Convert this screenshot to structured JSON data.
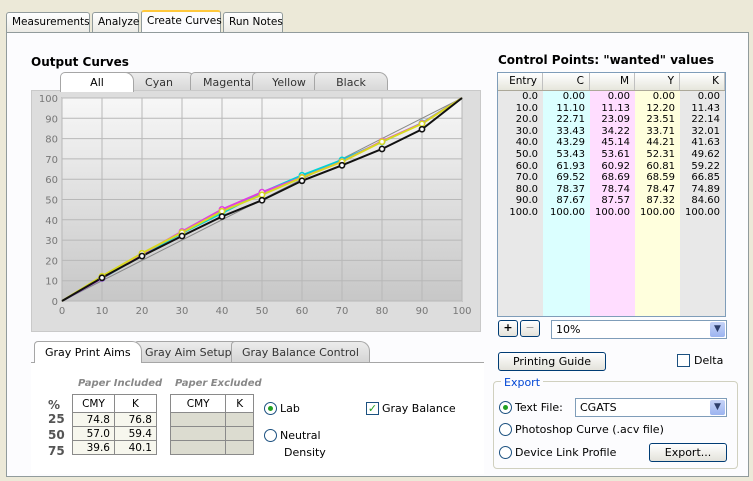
{
  "top_tabs": [
    "Measurements",
    "Analyze",
    "Create Curves",
    "Run Notes"
  ],
  "top_tab_active": "Create Curves",
  "output_curves": {
    "title": "Output Curves",
    "channel_tabs": [
      "All",
      "Cyan",
      "Magenta",
      "Yellow",
      "Black"
    ],
    "active_tab": "All"
  },
  "chart_data": {
    "type": "line",
    "x_ticks": [
      "0",
      "10",
      "20",
      "30",
      "40",
      "50",
      "60",
      "70",
      "80",
      "90",
      "100"
    ],
    "y_ticks": [
      "0",
      "10",
      "20",
      "30",
      "40",
      "50",
      "60",
      "70",
      "80",
      "90",
      "100"
    ],
    "xlim": [
      0,
      100
    ],
    "ylim": [
      0,
      100
    ],
    "grid": true,
    "x": [
      0,
      10,
      20,
      30,
      40,
      50,
      60,
      70,
      80,
      90,
      100
    ],
    "series": [
      {
        "color": "#00d4d4",
        "values": [
          0,
          11.1,
          22.71,
          33.43,
          43.29,
          53.43,
          61.93,
          69.52,
          78.37,
          87.67,
          100
        ]
      },
      {
        "color": "#e040e0",
        "values": [
          0,
          11.13,
          23.09,
          34.22,
          45.14,
          53.61,
          60.92,
          68.69,
          78.74,
          87.57,
          100
        ]
      },
      {
        "color": "#d8d820",
        "values": [
          0,
          12.2,
          23.51,
          33.71,
          44.21,
          52.31,
          60.81,
          68.59,
          78.47,
          87.32,
          100
        ]
      },
      {
        "color": "#111111",
        "values": [
          0,
          11.43,
          22.14,
          32.01,
          41.63,
          49.62,
          59.22,
          66.85,
          74.89,
          84.6,
          100
        ]
      }
    ]
  },
  "bottom_tabs": [
    "Gray Print Aims",
    "Gray Aim Setup",
    "Gray Balance Control"
  ],
  "bottom_tab_active": "Gray Print Aims",
  "gray_aims": {
    "pct_label": "%",
    "rows": [
      "25",
      "50",
      "75"
    ],
    "paper_included": {
      "title": "Paper Included",
      "headers": [
        "CMY",
        "K"
      ],
      "values": [
        [
          "74.8",
          "76.8"
        ],
        [
          "57.0",
          "59.4"
        ],
        [
          "39.6",
          "40.1"
        ]
      ]
    },
    "paper_excluded": {
      "title": "Paper Excluded",
      "headers": [
        "CMY",
        "K"
      ]
    },
    "mode_options": [
      "Lab",
      "Neutral",
      "Density"
    ],
    "mode_selected": "Lab",
    "gray_balance_label": "Gray Balance",
    "gray_balance_checked": true
  },
  "control_points": {
    "title": "Control Points: \"wanted\" values",
    "headers": [
      "Entry",
      "C",
      "M",
      "Y",
      "K"
    ],
    "rows": [
      [
        "0.0",
        "0.00",
        "0.00",
        "0.00",
        "0.00"
      ],
      [
        "10.0",
        "11.10",
        "11.13",
        "12.20",
        "11.43"
      ],
      [
        "20.0",
        "22.71",
        "23.09",
        "23.51",
        "22.14"
      ],
      [
        "30.0",
        "33.43",
        "34.22",
        "33.71",
        "32.01"
      ],
      [
        "40.0",
        "43.29",
        "45.14",
        "44.21",
        "41.63"
      ],
      [
        "50.0",
        "53.43",
        "53.61",
        "52.31",
        "49.62"
      ],
      [
        "60.0",
        "61.93",
        "60.92",
        "60.81",
        "59.22"
      ],
      [
        "70.0",
        "69.52",
        "68.69",
        "68.59",
        "66.85"
      ],
      [
        "80.0",
        "78.37",
        "78.74",
        "78.47",
        "74.89"
      ],
      [
        "90.0",
        "87.67",
        "87.57",
        "87.32",
        "84.60"
      ],
      [
        "100.0",
        "100.00",
        "100.00",
        "100.00",
        "100.00"
      ]
    ],
    "add_label": "+",
    "remove_label": "−",
    "step_value": "10%"
  },
  "printing_guide_label": "Printing Guide",
  "delta_label": "Delta",
  "export": {
    "title": "Export",
    "text_file_label": "Text File:",
    "text_file_format": "CGATS",
    "photoshop_label": "Photoshop Curve (.acv file)",
    "device_link_label": "Device Link Profile",
    "export_button": "Export...",
    "selected": "Text File"
  }
}
